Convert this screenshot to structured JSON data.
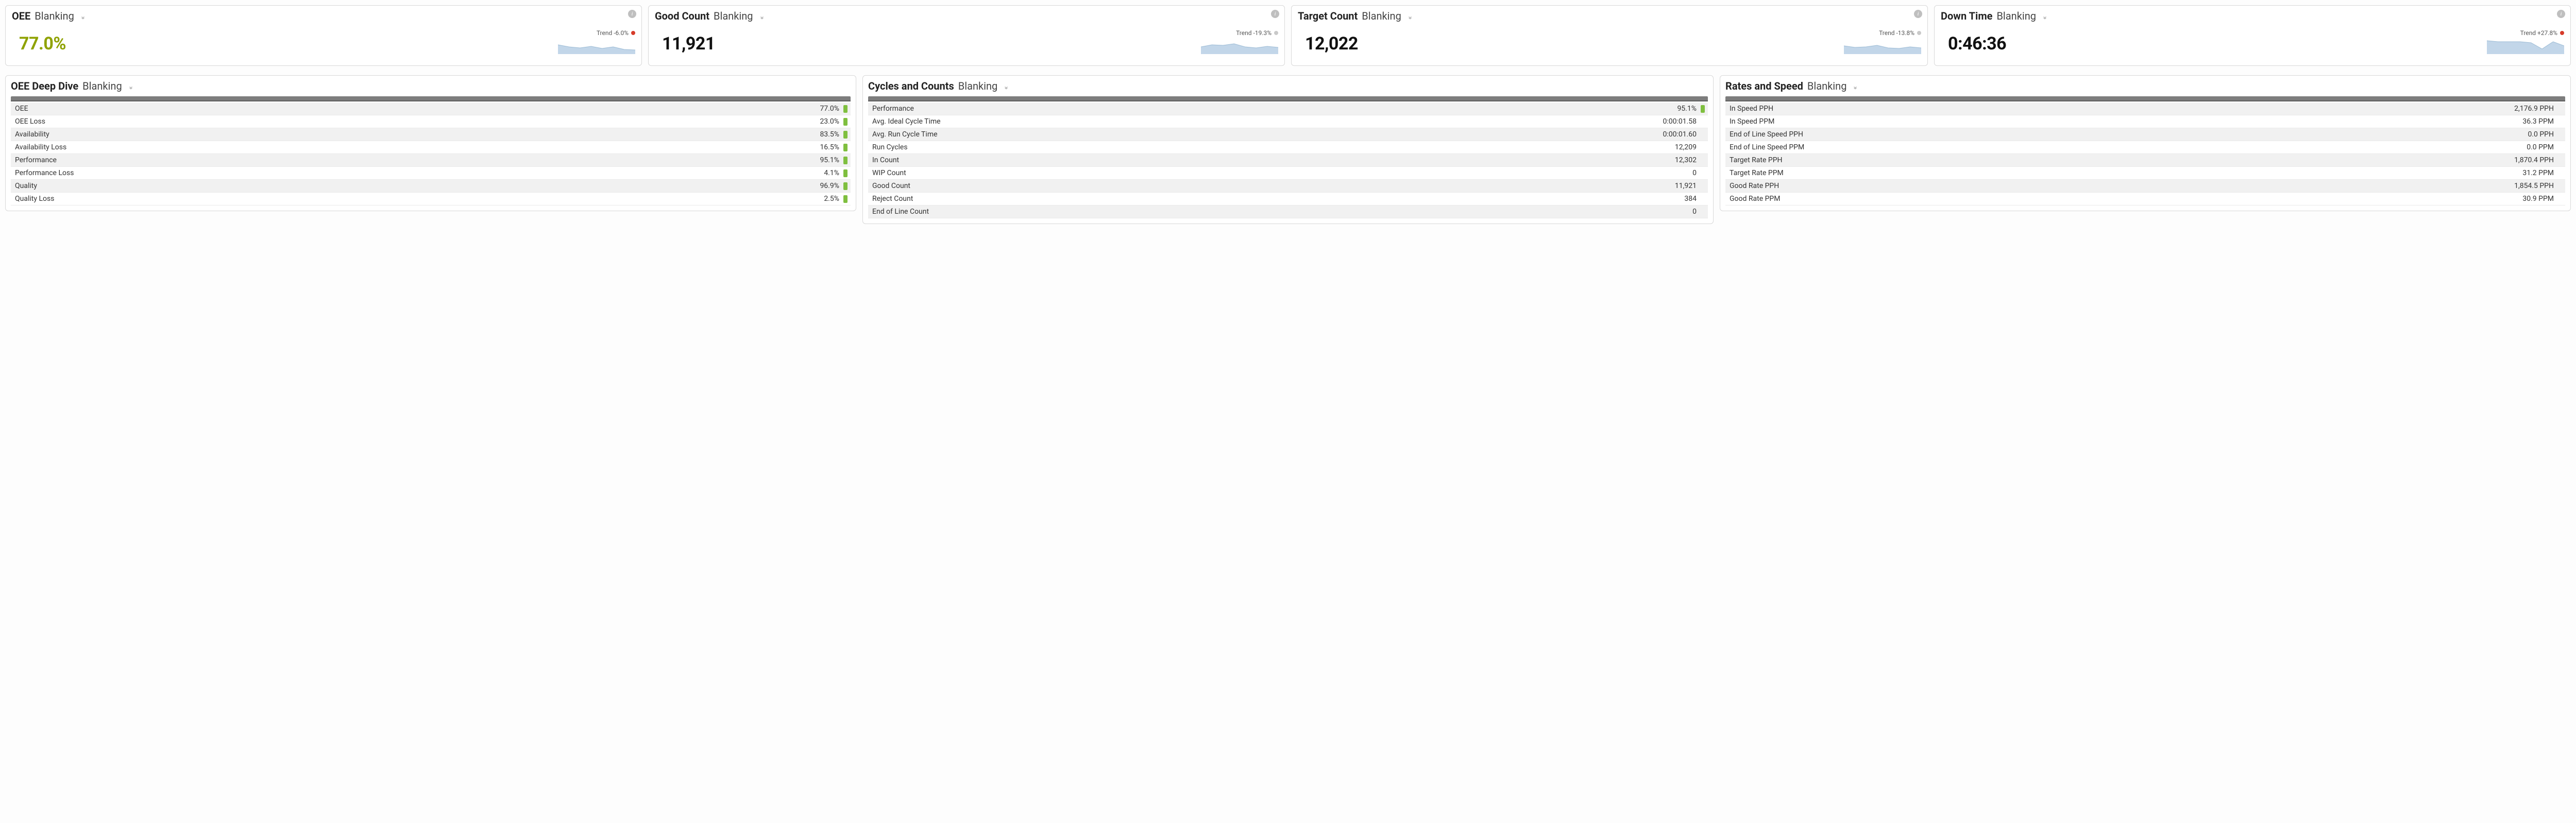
{
  "kpis": [
    {
      "title": "OEE",
      "sub": "Blanking",
      "value": "77.0%",
      "valueClass": "olive",
      "trend": "Trend -6.0%",
      "dot": "red",
      "spark": [
        18,
        14,
        12,
        15,
        11,
        14,
        9,
        8
      ]
    },
    {
      "title": "Good Count",
      "sub": "Blanking",
      "value": "11,921",
      "valueClass": "black",
      "trend": "Trend -19.3%",
      "dot": "grey",
      "spark": [
        14,
        18,
        17,
        20,
        14,
        12,
        15,
        13
      ]
    },
    {
      "title": "Target Count",
      "sub": "Blanking",
      "value": "12,022",
      "valueClass": "black",
      "trend": "Trend -13.8%",
      "dot": "grey",
      "spark": [
        16,
        13,
        14,
        17,
        12,
        11,
        14,
        12
      ]
    },
    {
      "title": "Down Time",
      "sub": "Blanking",
      "value": "0:46:36",
      "valueClass": "black",
      "trend": "Trend +27.8%",
      "dot": "red",
      "spark": [
        26,
        24,
        24,
        24,
        22,
        10,
        24,
        16
      ]
    }
  ],
  "panels": {
    "deepdive": {
      "title": "OEE Deep Dive",
      "sub": "Blanking",
      "rows": [
        {
          "label": "OEE",
          "value": "77.0%",
          "pip": true
        },
        {
          "label": "OEE Loss",
          "value": "23.0%",
          "pip": true
        },
        {
          "label": "Availability",
          "value": "83.5%",
          "pip": true
        },
        {
          "label": "Availability Loss",
          "value": "16.5%",
          "pip": true
        },
        {
          "label": "Performance",
          "value": "95.1%",
          "pip": true
        },
        {
          "label": "Performance Loss",
          "value": "4.1%",
          "pip": true
        },
        {
          "label": "Quality",
          "value": "96.9%",
          "pip": true
        },
        {
          "label": "Quality Loss",
          "value": "2.5%",
          "pip": true
        }
      ]
    },
    "cycles": {
      "title": "Cycles and Counts",
      "sub": "Blanking",
      "rows": [
        {
          "label": "Performance",
          "value": "95.1%",
          "pip": true
        },
        {
          "label": "Avg. Ideal Cycle Time",
          "value": "0:00:01.58",
          "pip": false
        },
        {
          "label": "Avg. Run Cycle Time",
          "value": "0:00:01.60",
          "pip": false
        },
        {
          "label": "Run Cycles",
          "value": "12,209",
          "pip": false
        },
        {
          "label": "In Count",
          "value": "12,302",
          "pip": false
        },
        {
          "label": "WIP Count",
          "value": "0",
          "pip": false
        },
        {
          "label": "Good Count",
          "value": "11,921",
          "pip": false
        },
        {
          "label": "Reject Count",
          "value": "384",
          "pip": false
        },
        {
          "label": "End of Line Count",
          "value": "0",
          "pip": false
        }
      ]
    },
    "rates": {
      "title": "Rates and Speed",
      "sub": "Blanking",
      "rows": [
        {
          "label": "In Speed PPH",
          "value": "2,176.9 PPH",
          "pip": false
        },
        {
          "label": "In Speed PPM",
          "value": "36.3 PPM",
          "pip": false
        },
        {
          "label": "End of Line Speed PPH",
          "value": "0.0 PPH",
          "pip": false
        },
        {
          "label": "End of Line Speed PPM",
          "value": "0.0 PPM",
          "pip": false
        },
        {
          "label": "Target Rate PPH",
          "value": "1,870.4 PPH",
          "pip": false
        },
        {
          "label": "Target Rate PPM",
          "value": "31.2 PPM",
          "pip": false
        },
        {
          "label": "Good Rate PPH",
          "value": "1,854.5 PPH",
          "pip": false
        },
        {
          "label": "Good Rate PPM",
          "value": "30.9 PPM",
          "pip": false
        }
      ]
    }
  },
  "glyphs": {
    "doubleDown": "»",
    "info": "i"
  }
}
